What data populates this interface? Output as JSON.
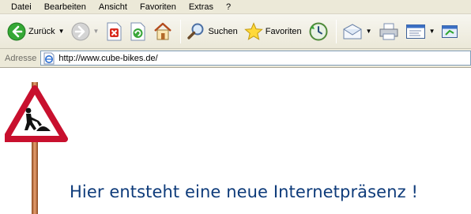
{
  "menu": {
    "items": [
      "Datei",
      "Bearbeiten",
      "Ansicht",
      "Favoriten",
      "Extras",
      "?"
    ]
  },
  "toolbar": {
    "back_label": "Zurück",
    "search_label": "Suchen",
    "favorites_label": "Favoriten"
  },
  "address": {
    "label": "Adresse",
    "url": "http://www.cube-bikes.de/"
  },
  "page": {
    "headline": "Hier entsteht eine neue Internetpräsenz !"
  },
  "colors": {
    "headline": "#0e3b7a",
    "sign_border": "#c8102e",
    "back_green": "#2ea52e"
  }
}
